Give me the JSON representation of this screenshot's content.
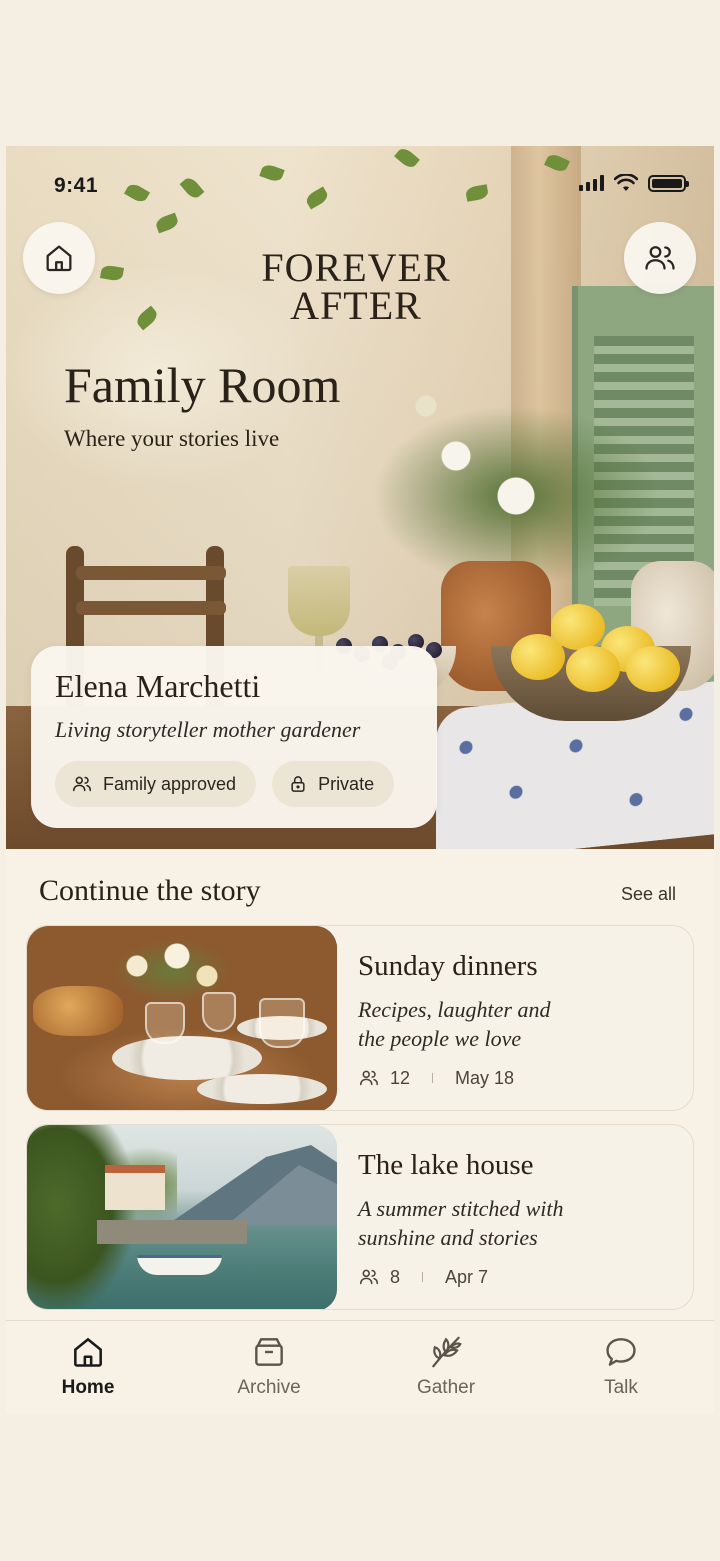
{
  "status_bar": {
    "time": "9:41"
  },
  "hero": {
    "logo_line1": "FOREVER",
    "logo_line2": "AFTER",
    "title": "Family Room",
    "subtitle": "Where your stories live"
  },
  "profile": {
    "name": "Elena Marchetti",
    "bio": "Living storyteller mother gardener",
    "chips": [
      {
        "label": "Family approved",
        "icon": "people-icon"
      },
      {
        "label": "Private",
        "icon": "lock-icon"
      }
    ]
  },
  "section": {
    "title": "Continue the story",
    "see_all": "See all"
  },
  "stories": [
    {
      "title": "Sunday dinners",
      "desc_line1": "Recipes, laughter and",
      "desc_line2": "the people we love",
      "members": "12",
      "date": "May 18"
    },
    {
      "title": "The lake house",
      "desc_line1": "A summer stitched with",
      "desc_line2": "sunshine and stories",
      "members": "8",
      "date": "Apr 7"
    }
  ],
  "nav": {
    "items": [
      {
        "label": "Home",
        "icon": "home-icon",
        "active": true
      },
      {
        "label": "Archive",
        "icon": "archive-icon",
        "active": false
      },
      {
        "label": "Gather",
        "icon": "leaf-icon",
        "active": false
      },
      {
        "label": "Talk",
        "icon": "chat-bubble-icon",
        "active": false
      }
    ]
  },
  "colors": {
    "background": "#f7f1e6",
    "text": "#2a2118",
    "chip_bg": "#ece5d6",
    "card_border": "#e3dccd"
  }
}
